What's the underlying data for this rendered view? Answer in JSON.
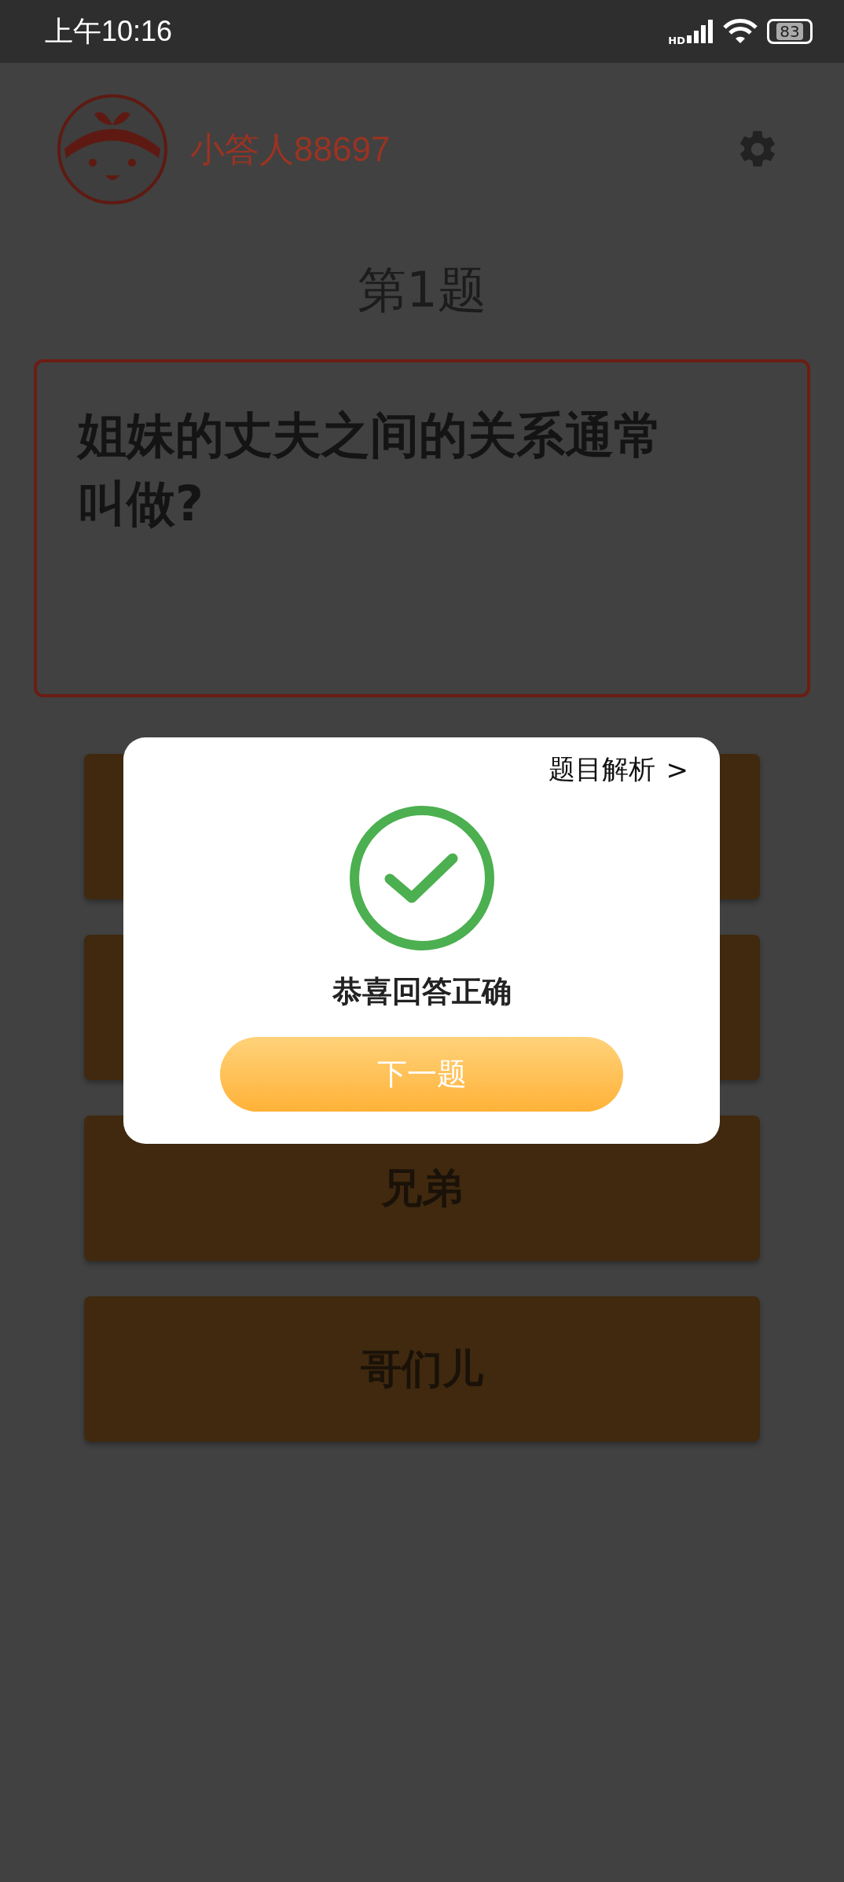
{
  "status_bar": {
    "time": "上午10:16",
    "network": "HD",
    "battery": "83"
  },
  "header": {
    "username": "小答人88697"
  },
  "question": {
    "number": "第1题",
    "text": "姐妹的丈夫之间的关系通常叫做?"
  },
  "options": [
    {
      "kind": "covered"
    },
    {
      "kind": "covered"
    },
    {
      "kind": "text",
      "label": "兄弟"
    },
    {
      "kind": "text",
      "label": "哥们儿"
    }
  ],
  "dialog": {
    "link": "题目解析",
    "chevron": ">",
    "message": "恭喜回答正确",
    "button": "下一题"
  }
}
